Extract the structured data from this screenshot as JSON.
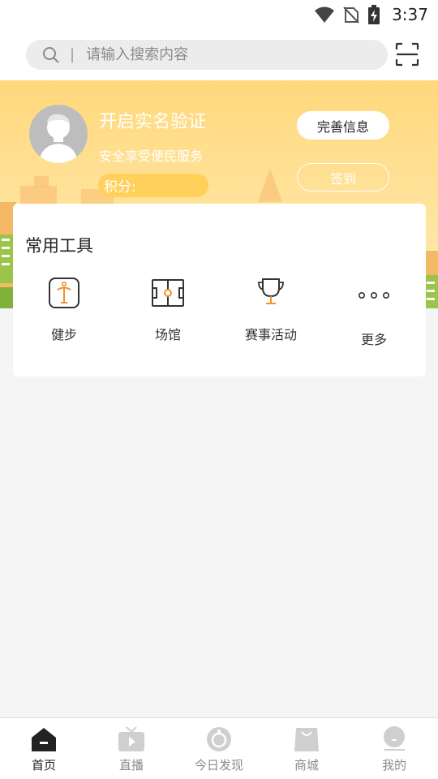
{
  "status_bar": {
    "time": "3:37"
  },
  "search": {
    "placeholder": "请输入搜索内容"
  },
  "banner": {
    "title": "开启实名验证",
    "subtitle": "安全享受便民服务",
    "points_label": "积分:",
    "complete_info_label": "完善信息",
    "sign_in_label": "签到"
  },
  "tools": {
    "title": "常用工具",
    "items": [
      {
        "label": "健步",
        "icon": "walk-icon"
      },
      {
        "label": "场馆",
        "icon": "stadium-icon"
      },
      {
        "label": "赛事活动",
        "icon": "trophy-icon"
      },
      {
        "label": "更多",
        "icon": "more-icon"
      }
    ]
  },
  "bottom_nav": {
    "items": [
      {
        "label": "首页",
        "icon": "home-icon",
        "active": true
      },
      {
        "label": "直播",
        "icon": "tv-icon",
        "active": false
      },
      {
        "label": "今日发现",
        "icon": "discover-icon",
        "active": false
      },
      {
        "label": "商城",
        "icon": "shop-bag-icon",
        "active": false
      },
      {
        "label": "我的",
        "icon": "profile-icon",
        "active": false
      }
    ]
  },
  "colors": {
    "accent": "#f0922e",
    "banner": "#ffd87c",
    "inactive": "#8a8a8a"
  }
}
